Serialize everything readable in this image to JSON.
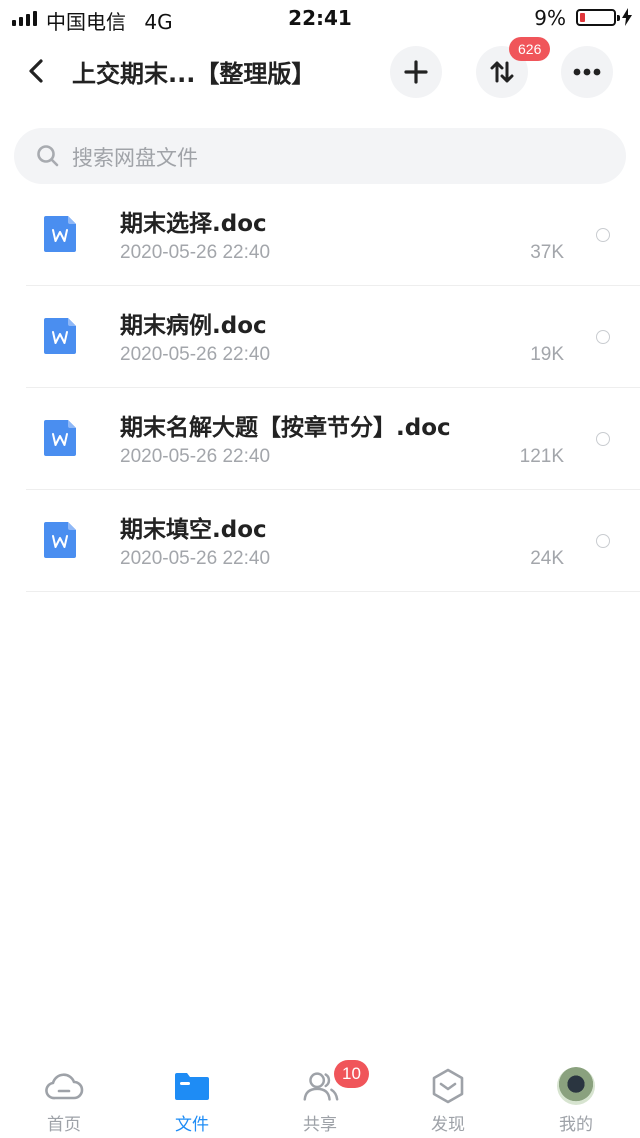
{
  "status_bar": {
    "carrier": "中国电信",
    "network": "4G",
    "time": "22:41",
    "battery_percent": "9%",
    "battery_level": 0.09,
    "battery_color": "#e0363b"
  },
  "header": {
    "title": "上交期末...【整理版】",
    "transfer_badge": "626",
    "icons": [
      "back-icon",
      "plus-icon",
      "transfer-icon",
      "more-icon"
    ]
  },
  "search": {
    "placeholder": "搜索网盘文件",
    "icon": "search-icon"
  },
  "files": [
    {
      "name": "期末选择.doc",
      "date": "2020-05-26 22:40",
      "size": "37K",
      "type": "word-doc-icon"
    },
    {
      "name": "期末病例.doc",
      "date": "2020-05-26 22:40",
      "size": "19K",
      "type": "word-doc-icon"
    },
    {
      "name": "期末名解大题【按章节分】.doc",
      "date": "2020-05-26 22:40",
      "size": "121K",
      "type": "word-doc-icon"
    },
    {
      "name": "期末填空.doc",
      "date": "2020-05-26 22:40",
      "size": "24K",
      "type": "word-doc-icon"
    }
  ],
  "tabbar": {
    "tabs": [
      {
        "label": "首页",
        "icon": "cloud-icon",
        "active": false
      },
      {
        "label": "文件",
        "icon": "folder-icon",
        "active": true
      },
      {
        "label": "共享",
        "icon": "people-icon",
        "active": false,
        "badge": "10"
      },
      {
        "label": "发现",
        "icon": "discover-icon",
        "active": false
      },
      {
        "label": "我的",
        "icon": "avatar",
        "active": false
      }
    ]
  },
  "colors": {
    "accent": "#1e8cf5",
    "badge": "#f0555a",
    "doc_icon": "#4a8ef0"
  }
}
